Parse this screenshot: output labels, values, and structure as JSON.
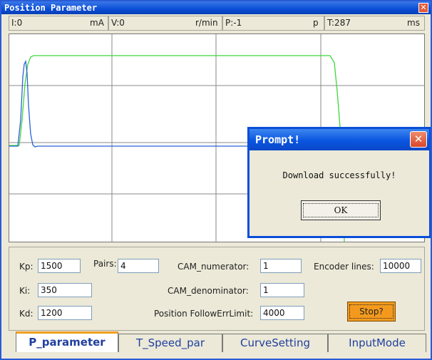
{
  "window": {
    "title": "Position Parameter",
    "close_glyph": "✕"
  },
  "status": {
    "current": "I:0",
    "current_unit": "mA",
    "velocity": "V:0",
    "velocity_unit": "r/min",
    "position": "P:-1",
    "position_unit": "p",
    "time": "T:287",
    "time_unit": "ms"
  },
  "plot": {
    "colors": {
      "series_a": "#2b7cff",
      "series_b": "#3cd83c",
      "grid": "#777777"
    }
  },
  "dialog": {
    "title": "Prompt!",
    "message": "Download successfully!",
    "ok_label": "OK",
    "close_glyph": "✕"
  },
  "params": {
    "kp_label": "Kp:",
    "kp_value": "1500",
    "ki_label": "Ki:",
    "ki_value": "350",
    "kd_label": "Kd:",
    "kd_value": "1200",
    "pairs_label": "Pairs:",
    "pairs_value": "4",
    "cam_num_label": "CAM_numerator:",
    "cam_num_value": "1",
    "cam_den_label": "CAM_denominator:",
    "cam_den_value": "1",
    "follow_label": "Position FollowErrLimit:",
    "follow_value": "4000",
    "encoder_label": "Encoder lines:",
    "encoder_value": "10000",
    "stop_label": "Stop?"
  },
  "tabs": [
    {
      "label": "P_parameter",
      "active": true
    },
    {
      "label": "T_Speed_par",
      "active": false
    },
    {
      "label": "CurveSetting",
      "active": false
    },
    {
      "label": "InputMode",
      "active": false
    }
  ]
}
